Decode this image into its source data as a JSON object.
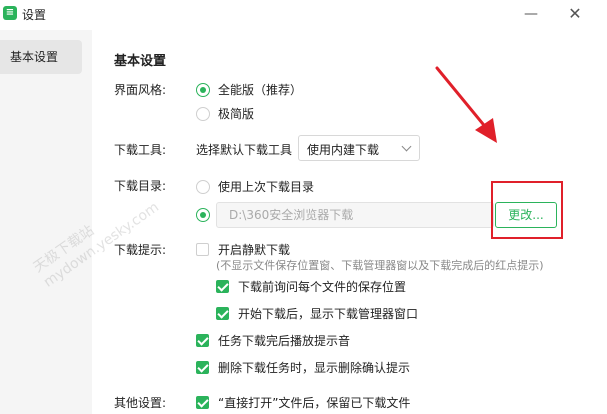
{
  "window": {
    "title": "设置",
    "app_icon": "app-logo-icon",
    "controls": {
      "minimize": "minimize-icon",
      "close": "close-icon"
    }
  },
  "sidebar": {
    "items": [
      {
        "label": "基本设置",
        "selected": true
      }
    ]
  },
  "main": {
    "title": "基本设置",
    "theme": {
      "label": "界面风格:",
      "options": [
        {
          "label": "全能版（推荐）",
          "selected": true
        },
        {
          "label": "极简版",
          "selected": false
        }
      ]
    },
    "download_tool": {
      "label": "下载工具:",
      "prompt": "选择默认下载工具",
      "selected": "使用内建下载"
    },
    "download_dir": {
      "label": "下载目录:",
      "option_last": "使用上次下载目录",
      "option_last_selected": false,
      "option_custom_selected": true,
      "path": "D:\\360安全浏览器下载",
      "change_button": "更改..."
    },
    "download_prompt": {
      "label": "下载提示:",
      "silent": {
        "label": "开启静默下载",
        "checked": false
      },
      "silent_hint": "(不显示文件保存位置窗、下载管理器窗以及下载完成后的红点提示)",
      "ask_location": {
        "label": "下载前询问每个文件的保存位置",
        "checked": true
      },
      "show_manager": {
        "label": "开始下载后，显示下载管理器窗口",
        "checked": true
      },
      "play_sound": {
        "label": "任务下载完后播放提示音",
        "checked": true
      },
      "confirm_delete": {
        "label": "删除下载任务时，显示删除确认提示",
        "checked": true
      }
    },
    "other": {
      "label": "其他设置:",
      "keep_file": {
        "label": "“直接打开”文件后，保留已下载文件",
        "checked": true
      }
    }
  },
  "watermark": {
    "line1": "天极下载站",
    "line2": "mydown.yesky.com"
  },
  "annotation": {
    "color": "#e0202a"
  },
  "colors": {
    "accent": "#2bb35b",
    "sidebar_bg": "#f5f5f5",
    "sidebar_selected": "#e6e6e6"
  }
}
